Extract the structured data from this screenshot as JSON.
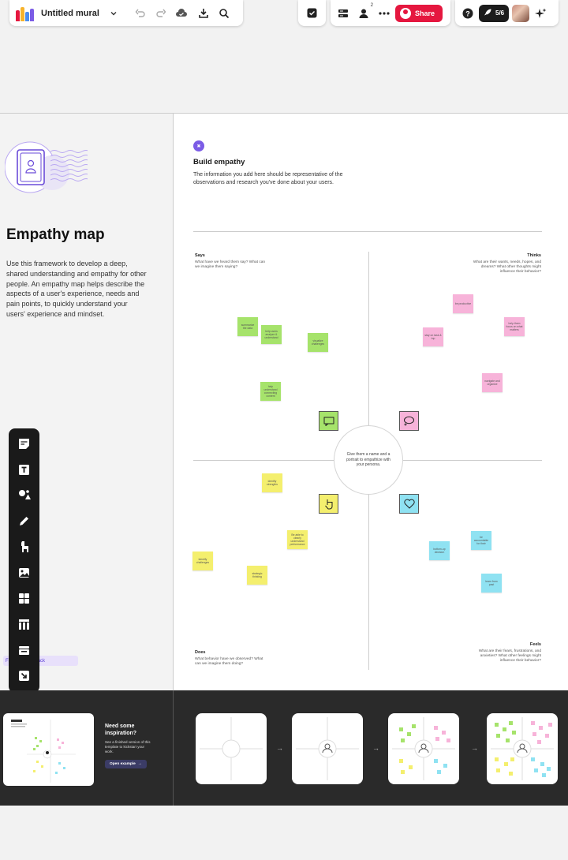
{
  "toolbar": {
    "title": "Untitled mural",
    "share_label": "Share",
    "members_count": "2",
    "progress_label": "5/6"
  },
  "left_panel": {
    "title": "Empathy map",
    "description": "Use this framework to develop a deep, shared understanding and empathy for other people. An empathy map helps describe the aspects of a user's experience, needs and pain points, to quickly understand your users' experience and mindset."
  },
  "section": {
    "step": "✖",
    "title": "Build empathy",
    "description": "The information you add here should be representative of the observations and research you've done about your users."
  },
  "quadrants": {
    "says": {
      "label": "Says",
      "sub": "What have we heard them say? What can we imagine them saying?"
    },
    "thinks": {
      "label": "Thinks",
      "sub": "What are their wants, needs, hopes, and dreams? What other thoughts might influence their behavior?"
    },
    "does": {
      "label": "Does",
      "sub": "What behavior have we observed? What can we imagine them doing?"
    },
    "feels": {
      "label": "Feels",
      "sub": "What are their fears, frustrations, and anxieties? What other feelings might influence their behavior?"
    },
    "center": "Give them a name and a portrait to empathize with your persona."
  },
  "stickies": {
    "g1": "summarize the data",
    "g2": "help users analyze & understand",
    "g3": "visualize challenges",
    "g4": "help understand connecting content",
    "p1": "be productive",
    "p2": "help them focus on what matters",
    "p3": "stay on task & top",
    "p4": "navigate and organize",
    "y1": "identify strengths",
    "y2": "identify challenges",
    "y3": "Be able to clearly understand performance",
    "y4": "strategic thinking",
    "b1": "bottom-up decision",
    "b2": "be accountable for their",
    "b3": "learn from past"
  },
  "feedback_chip": "Facilitate feedback",
  "example": {
    "title": "Need some inspiration?",
    "description": "See a finished version of this template to kickstart your work.",
    "button": "Open example"
  },
  "icons": {
    "arrow": "→",
    "caret": "⌄"
  },
  "colors": {
    "share": "#e5173f",
    "accent": "#7b5ce6",
    "sticky_green": "#a6e36b",
    "sticky_pink": "#f7b3d9",
    "sticky_yellow": "#f4ef6e",
    "sticky_blue": "#8fe2f2"
  }
}
